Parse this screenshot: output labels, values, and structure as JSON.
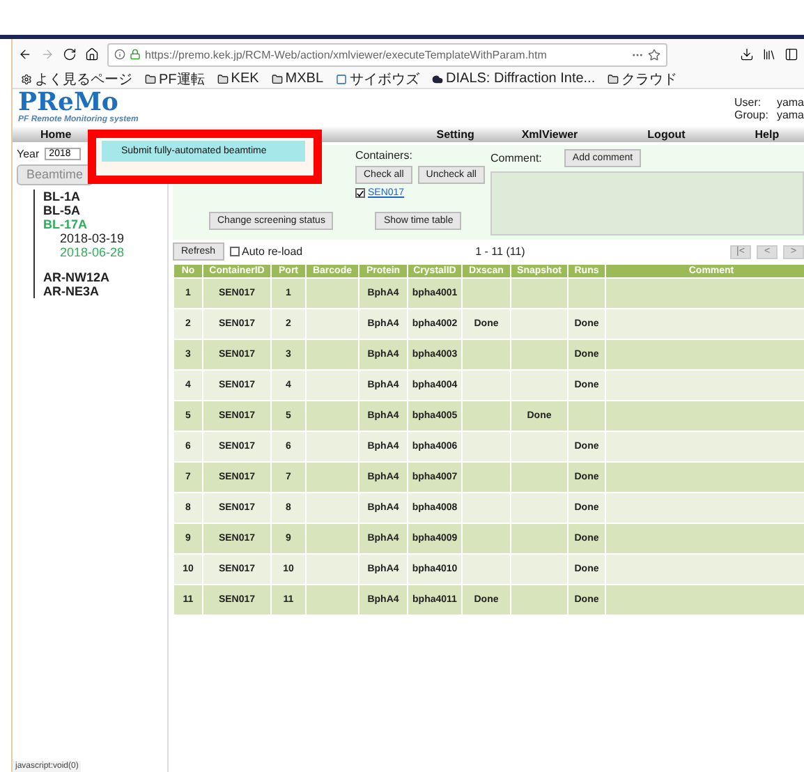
{
  "browser": {
    "url": "https://premo.kek.jp/RCM-Web/action/xmlviewer/executeTemplateWithParam.htm",
    "bookmarks": [
      {
        "label": "よく見るページ",
        "kind": "gear"
      },
      {
        "label": "PF運転",
        "kind": "folder"
      },
      {
        "label": "KEK",
        "kind": "folder"
      },
      {
        "label": "MXBL",
        "kind": "folder"
      },
      {
        "label": "サイボウズ",
        "kind": "app"
      },
      {
        "label": "DIALS: Diffraction Inte...",
        "kind": "cloud"
      },
      {
        "label": "クラウド",
        "kind": "folder"
      }
    ],
    "status_text": "javascript:void(0)"
  },
  "header": {
    "logo": "PReMo",
    "subtitle": "PF Remote Monitoring system",
    "user_label": "User:",
    "user": "yama",
    "group_label": "Group:",
    "group": "yama"
  },
  "nav": [
    "Home",
    "Setting",
    "XmlViewer",
    "Logout",
    "Help"
  ],
  "menu": {
    "highlighted": true,
    "items": [
      {
        "label": "Submit fully-automated beamtime",
        "selected": true
      }
    ]
  },
  "sidebar": {
    "year_label": "Year",
    "year": "2018",
    "beamtime_button": "Beamtime",
    "tree": [
      {
        "label": "BL-1A",
        "selected": false
      },
      {
        "label": "BL-5A",
        "selected": false
      },
      {
        "label": "BL-17A",
        "selected": true,
        "children": [
          {
            "label": "2018-03-19",
            "selected": false
          },
          {
            "label": "2018-06-28",
            "selected": true
          }
        ]
      },
      {
        "label": "AR-NW12A",
        "selected": false
      },
      {
        "label": "AR-NE3A",
        "selected": false
      }
    ]
  },
  "panel": {
    "containers_label": "Containers:",
    "check_all": "Check all",
    "uncheck_all": "Uncheck all",
    "containers": [
      {
        "label": "SEN017",
        "checked": true
      }
    ],
    "comment_label": "Comment:",
    "add_comment": "Add comment",
    "change_status": "Change screening status",
    "time_table": "Show time table"
  },
  "toolbar": {
    "refresh": "Refresh",
    "auto_reload": {
      "label": "Auto re-load",
      "checked": false
    },
    "range": "1 - 11 (11)",
    "pager": [
      "|<",
      "<",
      ">"
    ]
  },
  "table": {
    "columns": [
      "No",
      "ContainerID",
      "Port",
      "Barcode",
      "Protein",
      "CrystalID",
      "Dxscan",
      "Snapshot",
      "Runs",
      "Comment"
    ],
    "rows": [
      [
        "1",
        "SEN017",
        "1",
        "",
        "BphA4",
        "bpha4001",
        "",
        "",
        "",
        ""
      ],
      [
        "2",
        "SEN017",
        "2",
        "",
        "BphA4",
        "bpha4002",
        "Done",
        "",
        "Done",
        ""
      ],
      [
        "3",
        "SEN017",
        "3",
        "",
        "BphA4",
        "bpha4003",
        "",
        "",
        "Done",
        ""
      ],
      [
        "4",
        "SEN017",
        "4",
        "",
        "BphA4",
        "bpha4004",
        "",
        "",
        "Done",
        ""
      ],
      [
        "5",
        "SEN017",
        "5",
        "",
        "BphA4",
        "bpha4005",
        "",
        "Done",
        "",
        ""
      ],
      [
        "6",
        "SEN017",
        "6",
        "",
        "BphA4",
        "bpha4006",
        "",
        "",
        "Done",
        ""
      ],
      [
        "7",
        "SEN017",
        "7",
        "",
        "BphA4",
        "bpha4007",
        "",
        "",
        "Done",
        ""
      ],
      [
        "8",
        "SEN017",
        "8",
        "",
        "BphA4",
        "bpha4008",
        "",
        "",
        "Done",
        ""
      ],
      [
        "9",
        "SEN017",
        "9",
        "",
        "BphA4",
        "bpha4009",
        "",
        "",
        "Done",
        ""
      ],
      [
        "10",
        "SEN017",
        "10",
        "",
        "BphA4",
        "bpha4010",
        "",
        "",
        "Done",
        ""
      ],
      [
        "11",
        "SEN017",
        "11",
        "",
        "BphA4",
        "bpha4011",
        "Done",
        "",
        "Done",
        ""
      ]
    ]
  }
}
